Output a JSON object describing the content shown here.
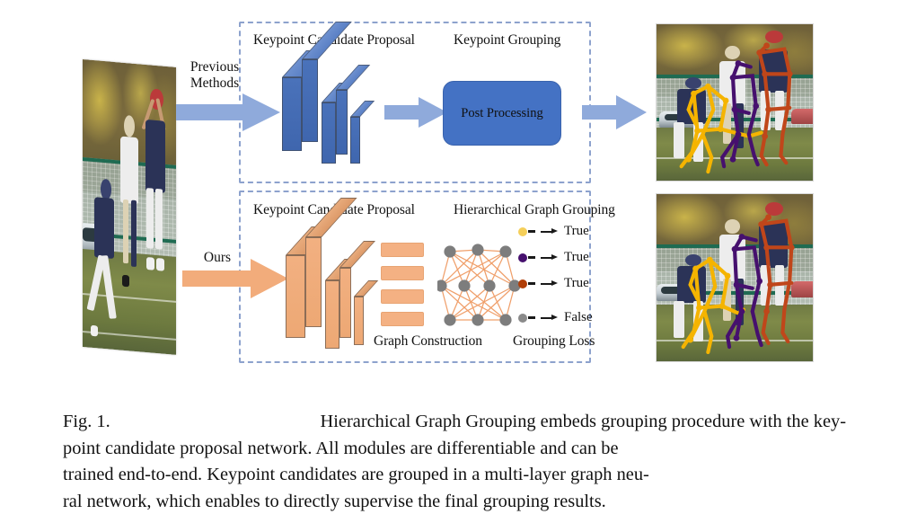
{
  "figure": {
    "pipelines": [
      {
        "id": "previous",
        "side_label_line1": "Previous",
        "side_label_line2": "Methods",
        "stage1_label": "Keypoint Candidate Proposal",
        "stage2_label": "Keypoint Grouping",
        "module_label": "Post Processing",
        "accent_color": "#8faadb",
        "block_color": "#4472c4"
      },
      {
        "id": "ours",
        "side_label_line1": "Ours",
        "side_label_line2": "",
        "stage1_label": "Keypoint Candidate Proposal",
        "stage2_label": "Hierarchical Graph Grouping",
        "footer_label_left": "Graph Construction",
        "footer_label_right": "Grouping Loss",
        "accent_color": "#f2ac7b",
        "block_color": "#f4b183"
      }
    ],
    "legend": {
      "title": "Hierarchical Graph Grouping",
      "rows": [
        {
          "color": "#f5cf5a",
          "label": "True"
        },
        {
          "color": "#46106e",
          "label": "True"
        },
        {
          "color": "#b03d07",
          "label": "True"
        },
        {
          "color": "#8a8a8a",
          "label": "False"
        }
      ]
    },
    "images": {
      "input_alt": "input-photo-football-players",
      "result_top_alt": "result-photo-previous-methods",
      "result_bottom_alt": "result-photo-ours"
    }
  },
  "caption": {
    "label": "Fig. 1.",
    "line1_rest": "Hierarchical Graph Grouping embeds grouping procedure with the key-",
    "line2": "point candidate proposal network. All modules are differentiable and can be",
    "line3": "trained end-to-end. Keypoint candidates are grouped in a multi-layer graph neu-",
    "line4": "ral network, which enables to directly supervise the final grouping results.",
    "full_text": "Fig. 1. Hierarchical Graph Grouping embeds grouping procedure with the keypoint candidate proposal network. All modules are differentiable and can be trained end-to-end. Keypoint candidates are grouped in a multi-layer graph neural network, which enables to directly supervise the final grouping results."
  }
}
